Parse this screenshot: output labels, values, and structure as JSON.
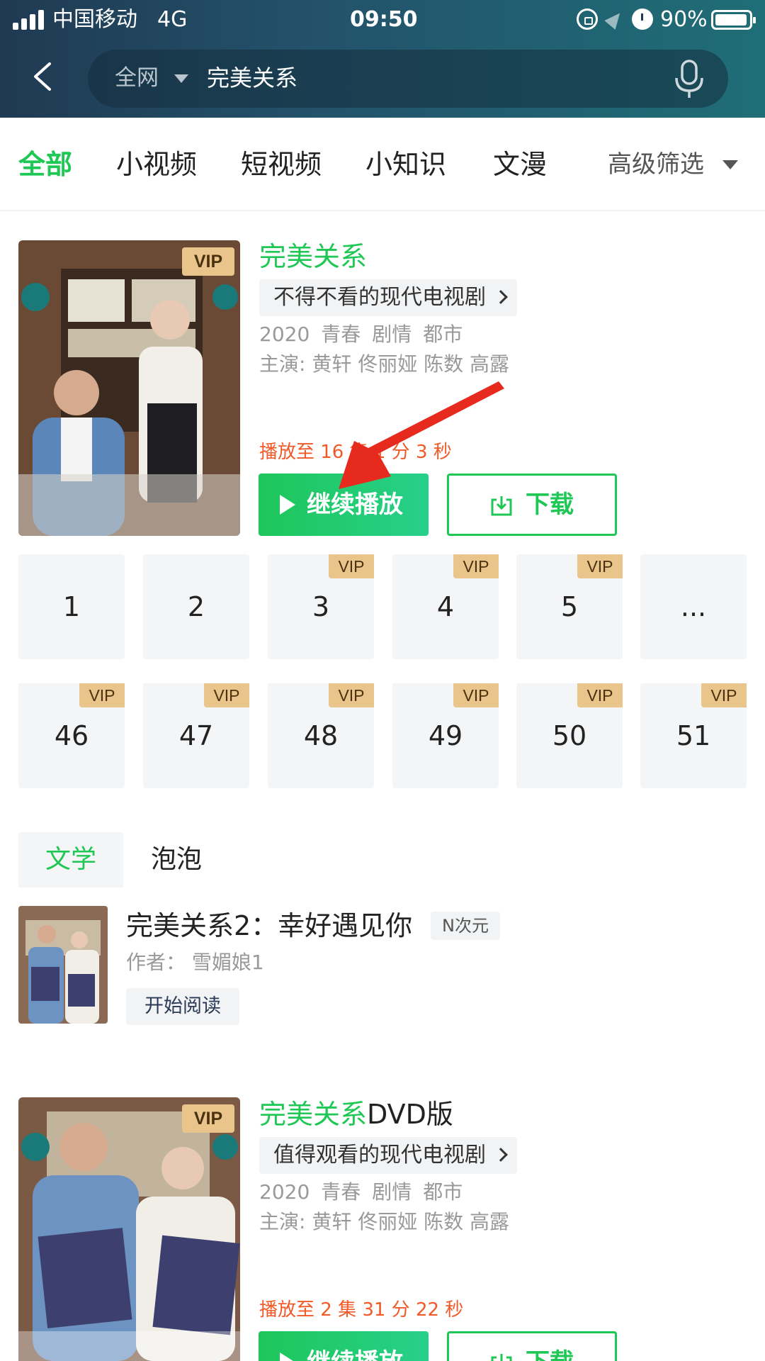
{
  "status_bar": {
    "carrier": "中国移动",
    "network": "4G",
    "time": "09:50",
    "battery": "90%"
  },
  "search": {
    "scope": "全网",
    "query": "完美关系"
  },
  "tabs": [
    {
      "label": "全部",
      "active": true
    },
    {
      "label": "小视频",
      "active": false
    },
    {
      "label": "短视频",
      "active": false
    },
    {
      "label": "小知识",
      "active": false
    },
    {
      "label": "文漫",
      "active": false
    }
  ],
  "filter_label": "高级筛选",
  "colors": {
    "accent_green": "#1fc754",
    "progress_orange": "#f05a28",
    "vip_gold": "#e9c58b",
    "header_dark": "#1f3a52"
  },
  "result1": {
    "badge": "VIP",
    "title_highlight": "完美关系",
    "title_suffix": "",
    "tagline": "不得不看的现代电视剧",
    "meta": [
      "2020",
      "青春",
      "剧情",
      "都市"
    ],
    "cast": "主演: 黄轩  佟丽娅  陈数  高露",
    "progress": "播放至 16 集 1 分 3 秒",
    "play_label": "继续播放",
    "download_label": "下载",
    "episodes": [
      {
        "num": "1",
        "vip": false
      },
      {
        "num": "2",
        "vip": false
      },
      {
        "num": "3",
        "vip": true
      },
      {
        "num": "4",
        "vip": true
      },
      {
        "num": "5",
        "vip": true
      },
      {
        "num": "...",
        "vip": false
      },
      {
        "num": "46",
        "vip": true
      },
      {
        "num": "47",
        "vip": true
      },
      {
        "num": "48",
        "vip": true
      },
      {
        "num": "49",
        "vip": true
      },
      {
        "num": "50",
        "vip": true
      },
      {
        "num": "51",
        "vip": true
      }
    ],
    "vip_label": "VIP"
  },
  "book_section": {
    "tabs": [
      "文学",
      "泡泡"
    ],
    "title": "完美关系2：幸好遇见你",
    "badge": "N次元",
    "author": "作者：  雪媚娘1",
    "read_label": "开始阅读"
  },
  "result2": {
    "badge": "VIP",
    "title_highlight": "完美关系",
    "title_suffix": "DVD版",
    "tagline": "值得观看的现代电视剧",
    "meta": [
      "2020",
      "青春",
      "剧情",
      "都市"
    ],
    "cast": "主演: 黄轩  佟丽娅  陈数  高露",
    "progress": "播放至 2 集 31 分 22 秒",
    "play_label": "继续播放",
    "download_label": "下载"
  }
}
